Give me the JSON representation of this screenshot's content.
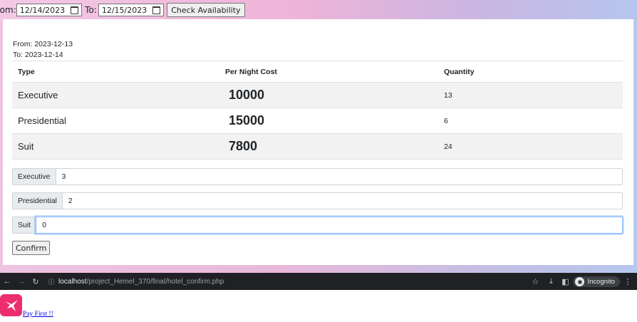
{
  "search": {
    "from_label": "rom:",
    "from_value": "12/14/2023",
    "to_label": "To:",
    "to_value": "12/15/2023",
    "button": "Check Availability"
  },
  "range": {
    "from": "From: 2023-12-13",
    "to": "To: 2023-12-14"
  },
  "table": {
    "headers": [
      "Type",
      "Per Night Cost",
      "Quantity"
    ],
    "rows": [
      {
        "type": "Executive",
        "cost": "10000",
        "qty": "13"
      },
      {
        "type": "Presidential",
        "cost": "15000",
        "qty": "6"
      },
      {
        "type": "Suit",
        "cost": "7800",
        "qty": "24"
      }
    ]
  },
  "booking": {
    "inputs": [
      {
        "label": "Executive",
        "value": "3"
      },
      {
        "label": "Presidential",
        "value": "2"
      },
      {
        "label": "Suit",
        "value": "0"
      }
    ],
    "confirm": "Confirm"
  },
  "browser": {
    "url_host": "localhost",
    "url_path": "/project_Hemel_370/final/hotel_confirm.php",
    "incognito": "Incognito"
  },
  "payment": {
    "link": "Pay First !!"
  },
  "colors": {
    "accent_logo": "#ee2d6e",
    "link": "#0000ee",
    "browser_bar": "#202124"
  }
}
